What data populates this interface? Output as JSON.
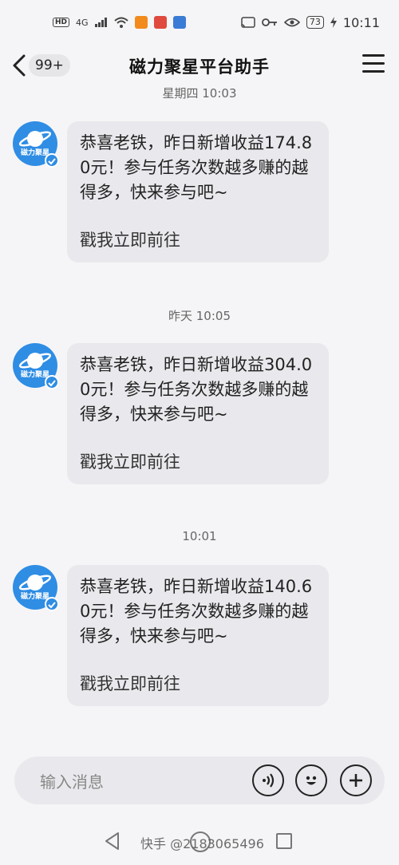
{
  "status": {
    "hd": "HD",
    "network": "4G",
    "battery": "73",
    "time": "10:11"
  },
  "header": {
    "badge": "99+",
    "title": "磁力聚星平台助手"
  },
  "avatar_label": "磁力聚星",
  "messages": [
    {
      "timestamp": "星期四 10:03",
      "text": "恭喜老铁，昨日新增收益174.80元！参与任务次数越多赚的越得多，快来参与吧~",
      "link": "戳我立即前往"
    },
    {
      "timestamp": "昨天 10:05",
      "text": "恭喜老铁，昨日新增收益304.00元！参与任务次数越多赚的越得多，快来参与吧~",
      "link": "戳我立即前往"
    },
    {
      "timestamp": "10:01",
      "text": "恭喜老铁，昨日新增收益140.60元！参与任务次数越多赚的越得多，快来参与吧~",
      "link": "戳我立即前往"
    }
  ],
  "input": {
    "placeholder": "输入消息"
  },
  "watermark": "快手 @2183065496",
  "colors": {
    "accent": "#2f8de4",
    "bubble": "#e9e9ed",
    "background": "#f5f5f7"
  }
}
